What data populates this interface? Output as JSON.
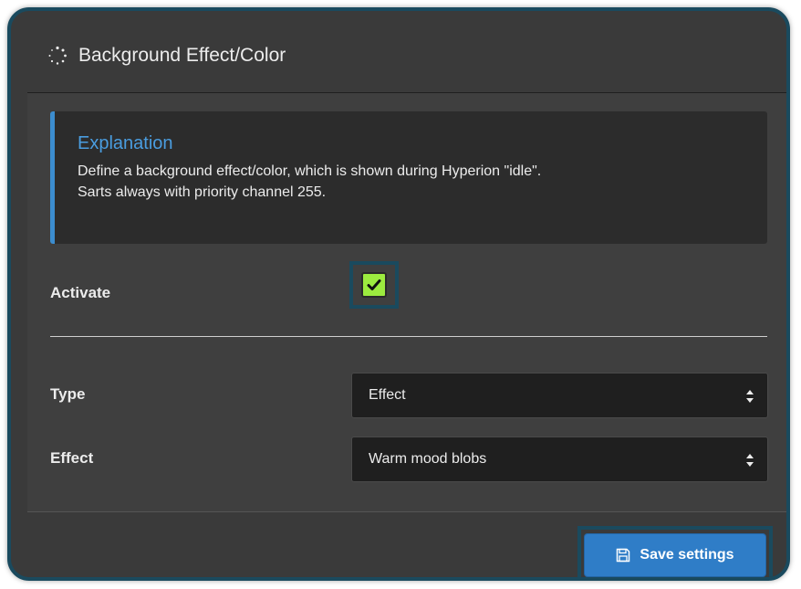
{
  "panel": {
    "title": "Background Effect/Color",
    "title_icon": "spinner-icon"
  },
  "explanation": {
    "title": "Explanation",
    "line1": "Define a background effect/color, which is shown during Hyperion \"idle\".",
    "line2": "Sarts always with priority channel 255."
  },
  "activate": {
    "label": "Activate",
    "checked": true
  },
  "type": {
    "label": "Type",
    "value": "Effect"
  },
  "effect": {
    "label": "Effect",
    "value": "Warm mood blobs"
  },
  "footer": {
    "save_label": "Save settings",
    "save_icon": "floppy-icon"
  },
  "colors": {
    "accent_blue": "#3c8dcf",
    "checkbox_green": "#9ceb3f",
    "save_button": "#2f7dc7",
    "highlight_border": "#1a4a5e"
  }
}
